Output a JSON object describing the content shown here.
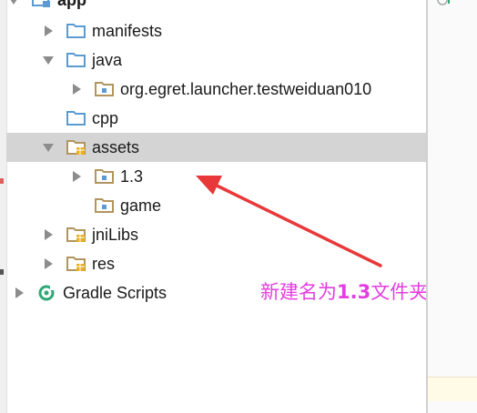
{
  "tree": {
    "items": [
      {
        "label": "app",
        "arrow": "down",
        "icon": "module-folder-icon",
        "bold": true
      },
      {
        "label": "manifests",
        "arrow": "right",
        "icon": "folder-icon"
      },
      {
        "label": "java",
        "arrow": "down",
        "icon": "folder-icon"
      },
      {
        "label": "org.egret.launcher.testweiduan010",
        "arrow": "right",
        "icon": "package-icon"
      },
      {
        "label": "cpp",
        "arrow": "none",
        "icon": "folder-icon"
      },
      {
        "label": "assets",
        "arrow": "down",
        "icon": "resource-folder-icon",
        "selected": true
      },
      {
        "label": "1.3",
        "arrow": "right",
        "icon": "package-icon"
      },
      {
        "label": "game",
        "arrow": "none",
        "icon": "package-icon"
      },
      {
        "label": "jniLibs",
        "arrow": "right",
        "icon": "resource-folder-icon"
      },
      {
        "label": "res",
        "arrow": "right",
        "icon": "resource-folder-icon"
      },
      {
        "label": "Gradle Scripts",
        "arrow": "right",
        "icon": "gradle-icon"
      }
    ]
  },
  "annotation": {
    "prefix": "新建名为",
    "number": "1.3",
    "suffix": "文件夹",
    "color": "#e33ee0"
  },
  "colors": {
    "selection": "#d4d4d4",
    "folder_blue": "#5b9bd1",
    "folder_tan": "#b2955e",
    "resource_yellow": "#e8b020",
    "arrow_red": "#e8383a"
  }
}
